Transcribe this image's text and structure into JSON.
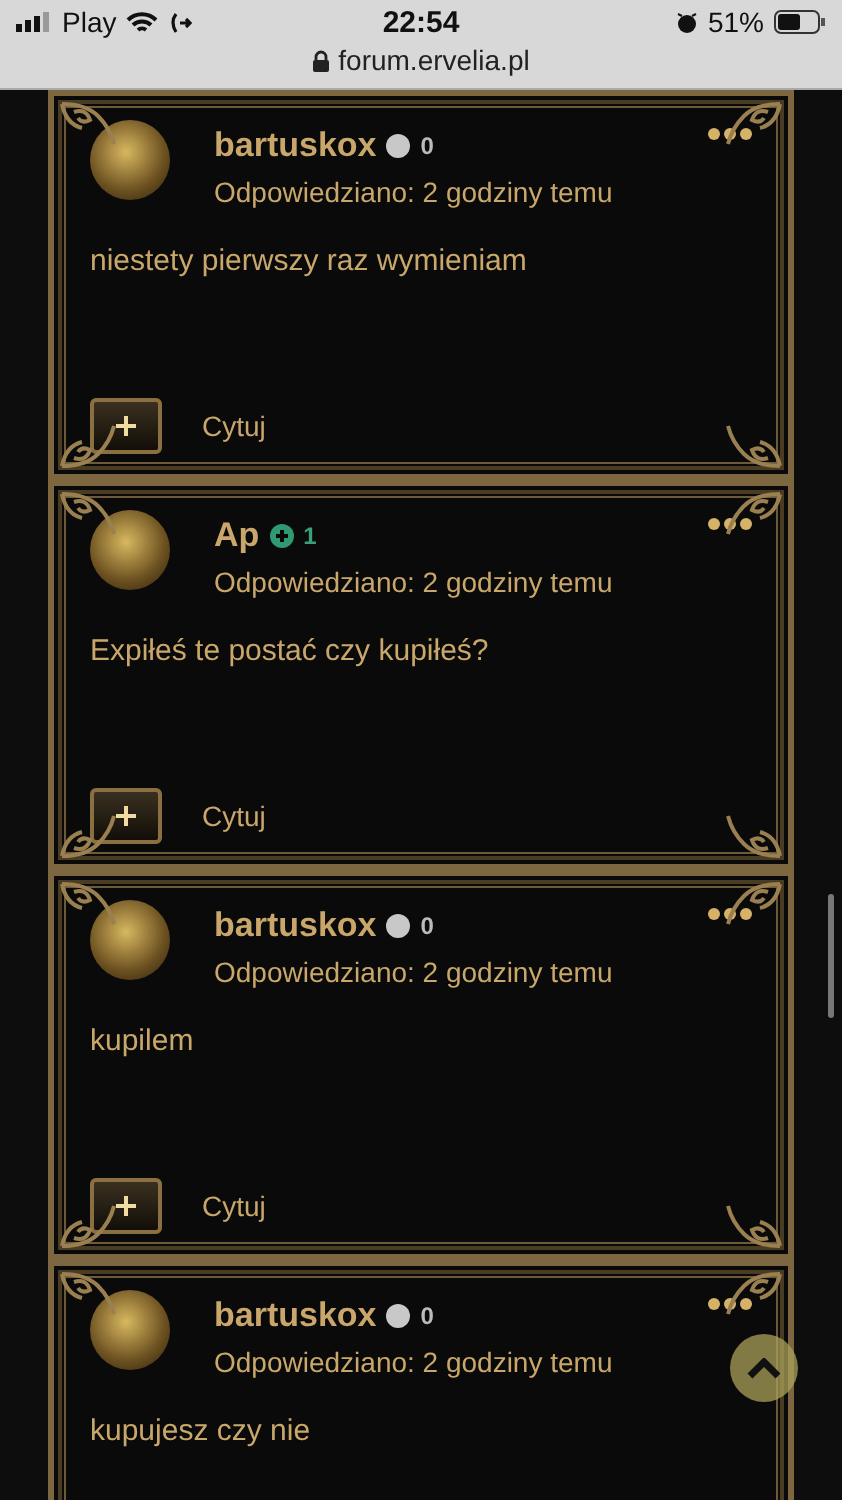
{
  "status_bar": {
    "carrier": "Play",
    "time": "22:54",
    "battery": "51%"
  },
  "address_bar": {
    "url": "forum.ervelia.pl"
  },
  "posts": [
    {
      "author": "bartuskox",
      "reputation_positive": false,
      "reputation": "0",
      "meta": "Odpowiedziano: 2 godziny temu",
      "body": "niestety pierwszy raz wymieniam",
      "quote_label": "Cytuj"
    },
    {
      "author": "Ap",
      "reputation_positive": true,
      "reputation": "1",
      "meta": "Odpowiedziano: 2 godziny temu",
      "body": "Expiłeś te postać czy kupiłeś?",
      "quote_label": "Cytuj"
    },
    {
      "author": "bartuskox",
      "reputation_positive": false,
      "reputation": "0",
      "meta": "Odpowiedziano: 2 godziny temu",
      "body": "kupilem",
      "quote_label": "Cytuj"
    },
    {
      "author": "bartuskox",
      "reputation_positive": false,
      "reputation": "0",
      "meta": "Odpowiedziano: 2 godziny temu",
      "body": "kupujesz czy nie"
    }
  ]
}
